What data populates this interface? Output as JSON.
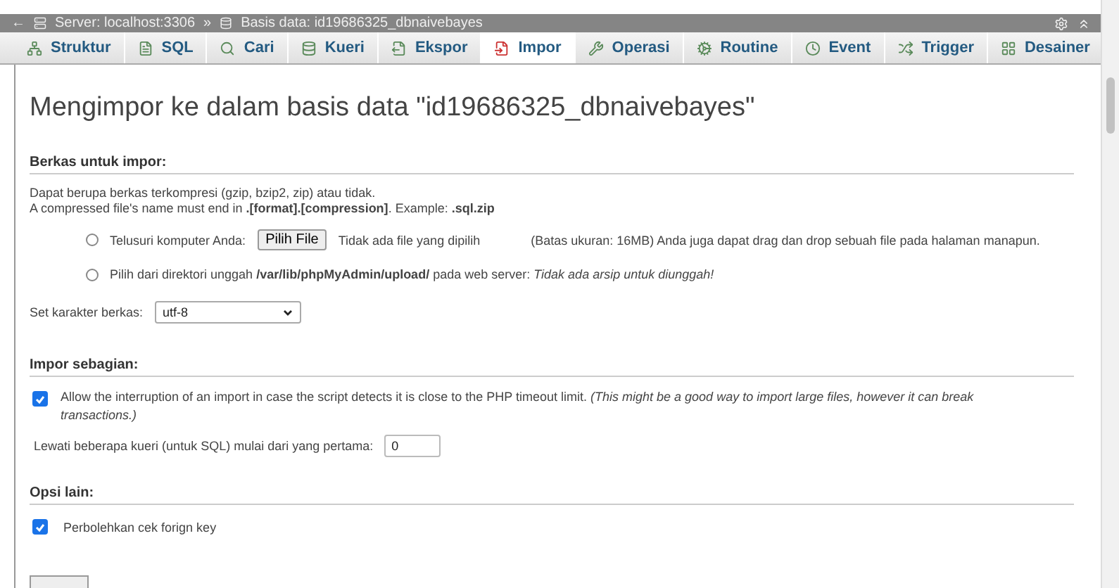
{
  "breadcrumb": {
    "back": "←",
    "server": "Server: localhost:3306",
    "separator": "»",
    "database": "Basis data: id19686325_dbnaivebayes"
  },
  "tabs": [
    {
      "label": "Struktur",
      "selected": false
    },
    {
      "label": "SQL",
      "selected": false
    },
    {
      "label": "Cari",
      "selected": false
    },
    {
      "label": "Kueri",
      "selected": false
    },
    {
      "label": "Ekspor",
      "selected": false
    },
    {
      "label": "Impor",
      "selected": true
    },
    {
      "label": "Operasi",
      "selected": false
    },
    {
      "label": "Routine",
      "selected": false
    },
    {
      "label": "Event",
      "selected": false
    },
    {
      "label": "Trigger",
      "selected": false
    },
    {
      "label": "Desainer",
      "selected": false
    }
  ],
  "title": "Mengimpor ke dalam basis data \"id19686325_dbnaivebayes\"",
  "file_section": {
    "heading": "Berkas untuk impor:",
    "note_1": "Dapat berupa berkas terkompresi (gzip, bzip2, zip) atau tidak.",
    "note_2": "A compressed file's name must end in **.[format].[compression]**. Example: **.sql.zip**",
    "sources": [
      {
        "kind": "upload",
        "selected": false,
        "label": "Telusuri komputer Anda:",
        "button": "Pilih File",
        "file_status": "Tidak ada file yang dipilih",
        "limit": "(Batas ukuran: 16MB) Anda juga dapat drag dan drop sebuah file pada halaman manapun."
      },
      {
        "kind": "directory",
        "selected": false,
        "label": "Pilih dari direktori unggah **/var/lib/phpMyAdmin/upload/** pada web server: *Tidak ada arsip untuk diunggah!*"
      }
    ],
    "charset_label": "Set karakter berkas:",
    "charset": "utf-8"
  },
  "partial_section": {
    "heading": "Impor sebagian:",
    "allow_interrupt": {
      "checked": true,
      "label": "Allow the interruption of an import in case the script detects it is close to the PHP timeout limit. *(This might be a good way to import large files, however it can break transactions.)*"
    },
    "skip_label": "Lewati beberapa kueri (untuk SQL) mulai dari yang pertama:",
    "skip_value": "0"
  },
  "other_section": {
    "heading": "Opsi lain:",
    "foreign_key": {
      "checked": true,
      "label": "Perbolehkan cek forign key"
    }
  }
}
